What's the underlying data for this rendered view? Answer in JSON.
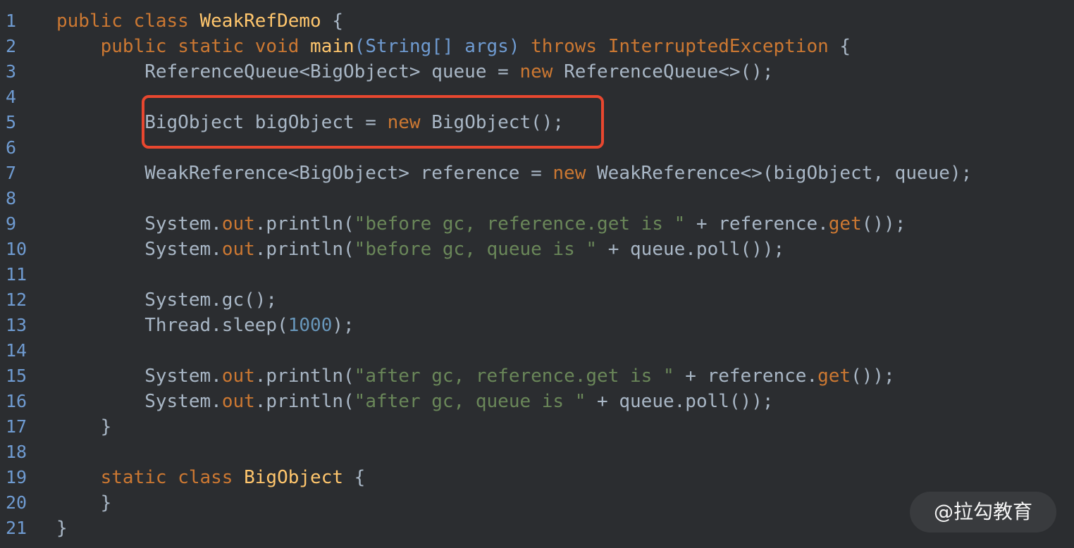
{
  "editor": {
    "lines": [
      {
        "num": "1",
        "segments": [
          {
            "t": "public class ",
            "c": "kw"
          },
          {
            "t": "WeakRefDemo",
            "c": "fn"
          },
          {
            "t": " {",
            "c": "typ"
          }
        ]
      },
      {
        "num": "2",
        "segments": [
          {
            "t": "    ",
            "c": "typ"
          },
          {
            "t": "public static void ",
            "c": "kw"
          },
          {
            "t": "main",
            "c": "fn"
          },
          {
            "t": "(String[] args) ",
            "c": "param"
          },
          {
            "t": "throws ",
            "c": "kw"
          },
          {
            "t": "InterruptedException",
            "c": "kw"
          },
          {
            "t": " {",
            "c": "typ"
          }
        ]
      },
      {
        "num": "3",
        "segments": [
          {
            "t": "        ReferenceQueue<BigObject> queue = ",
            "c": "typ"
          },
          {
            "t": "new ",
            "c": "kw"
          },
          {
            "t": "ReferenceQueue<>();",
            "c": "typ"
          }
        ]
      },
      {
        "num": "4",
        "segments": []
      },
      {
        "num": "5",
        "segments": [
          {
            "t": "        BigObject bigObject = ",
            "c": "typ"
          },
          {
            "t": "new ",
            "c": "kw"
          },
          {
            "t": "BigObject();",
            "c": "typ"
          }
        ]
      },
      {
        "num": "6",
        "segments": []
      },
      {
        "num": "7",
        "segments": [
          {
            "t": "        WeakReference<BigObject> reference = ",
            "c": "typ"
          },
          {
            "t": "new ",
            "c": "kw"
          },
          {
            "t": "WeakReference<>(bigObject, queue);",
            "c": "typ"
          }
        ]
      },
      {
        "num": "8",
        "segments": []
      },
      {
        "num": "9",
        "segments": [
          {
            "t": "        System.",
            "c": "typ"
          },
          {
            "t": "out",
            "c": "field"
          },
          {
            "t": ".println(",
            "c": "typ"
          },
          {
            "t": "\"before gc, reference.get is \"",
            "c": "str"
          },
          {
            "t": " + reference.",
            "c": "typ"
          },
          {
            "t": "get",
            "c": "field"
          },
          {
            "t": "());",
            "c": "typ"
          }
        ]
      },
      {
        "num": "10",
        "segments": [
          {
            "t": "        System.",
            "c": "typ"
          },
          {
            "t": "out",
            "c": "field"
          },
          {
            "t": ".println(",
            "c": "typ"
          },
          {
            "t": "\"before gc, queue is \"",
            "c": "str"
          },
          {
            "t": " + queue.poll());",
            "c": "typ"
          }
        ]
      },
      {
        "num": "11",
        "segments": []
      },
      {
        "num": "12",
        "segments": [
          {
            "t": "        System.gc();",
            "c": "typ"
          }
        ]
      },
      {
        "num": "13",
        "segments": [
          {
            "t": "        Thread.sleep(",
            "c": "typ"
          },
          {
            "t": "1000",
            "c": "num"
          },
          {
            "t": ");",
            "c": "typ"
          }
        ]
      },
      {
        "num": "14",
        "segments": []
      },
      {
        "num": "15",
        "segments": [
          {
            "t": "        System.",
            "c": "typ"
          },
          {
            "t": "out",
            "c": "field"
          },
          {
            "t": ".println(",
            "c": "typ"
          },
          {
            "t": "\"after gc, reference.get is \"",
            "c": "str"
          },
          {
            "t": " + reference.",
            "c": "typ"
          },
          {
            "t": "get",
            "c": "field"
          },
          {
            "t": "());",
            "c": "typ"
          }
        ]
      },
      {
        "num": "16",
        "segments": [
          {
            "t": "        System.",
            "c": "typ"
          },
          {
            "t": "out",
            "c": "field"
          },
          {
            "t": ".println(",
            "c": "typ"
          },
          {
            "t": "\"after gc, queue is \"",
            "c": "str"
          },
          {
            "t": " + queue.poll());",
            "c": "typ"
          }
        ]
      },
      {
        "num": "17",
        "segments": [
          {
            "t": "    }",
            "c": "typ"
          }
        ]
      },
      {
        "num": "18",
        "segments": []
      },
      {
        "num": "19",
        "segments": [
          {
            "t": "    ",
            "c": "typ"
          },
          {
            "t": "static class ",
            "c": "kw"
          },
          {
            "t": "BigObject",
            "c": "fn"
          },
          {
            "t": " {",
            "c": "typ"
          }
        ]
      },
      {
        "num": "20",
        "segments": [
          {
            "t": "    }",
            "c": "typ"
          }
        ]
      },
      {
        "num": "21",
        "segments": [
          {
            "t": "}",
            "c": "typ"
          }
        ]
      }
    ]
  },
  "highlight": {
    "color": "#e8472f",
    "line": "5"
  },
  "watermark": {
    "text": "@拉勾教育"
  },
  "colors": {
    "background": "#2b2d30",
    "keyword": "#cc7832",
    "function": "#ffc66d",
    "string": "#6a8759",
    "number": "#6897bb",
    "line_number": "#6f9bd1",
    "default": "#a9b7c6"
  }
}
